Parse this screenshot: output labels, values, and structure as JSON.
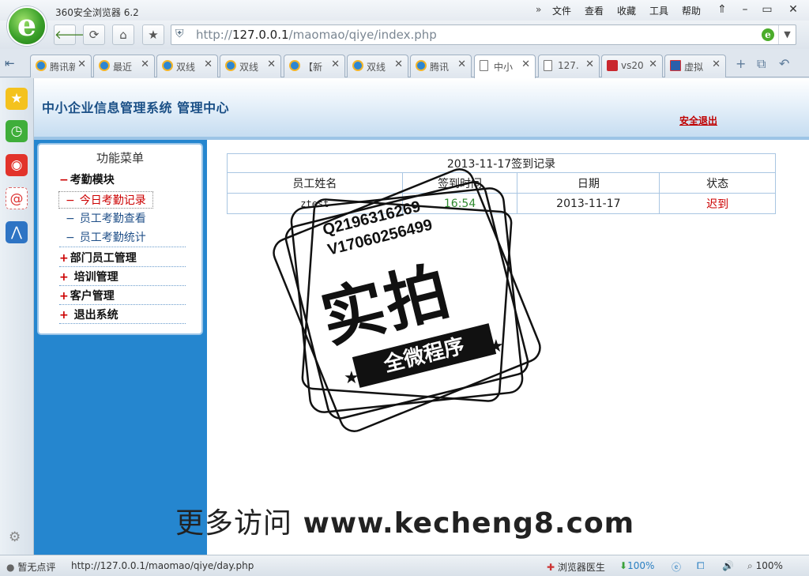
{
  "browser": {
    "app_title": "360安全浏览器 6.2",
    "menu_more": "»",
    "menus": [
      "文件",
      "查看",
      "收藏",
      "工具",
      "帮助"
    ],
    "window_buttons": [
      "⇑",
      "–",
      "▭",
      "✕"
    ],
    "address": {
      "scheme": "http://",
      "host": "127.0.0.1",
      "path": "/maomao/qiye/index.php"
    },
    "tabs": [
      {
        "label": "腾讯新",
        "icon": "ie-icon"
      },
      {
        "label": "最近",
        "icon": "ie-icon"
      },
      {
        "label": "双线",
        "icon": "ie-icon"
      },
      {
        "label": "双线",
        "icon": "ie-icon"
      },
      {
        "label": "【新",
        "icon": "ie-icon"
      },
      {
        "label": "双线",
        "icon": "ie-icon"
      },
      {
        "label": "腾讯",
        "icon": "ie-icon"
      },
      {
        "label": "中小",
        "icon": "doc-icon"
      },
      {
        "label": "127.",
        "icon": "doc-icon"
      },
      {
        "label": "vs20",
        "icon": "csdn-icon"
      },
      {
        "label": "虚拟",
        "icon": "vm-icon"
      }
    ],
    "status": {
      "left": "暂无点评",
      "url": "http://127.0.0.1/maomao/qiye/day.php",
      "doctor": "浏览器医生",
      "download": "100%",
      "zoom": "100%"
    }
  },
  "site": {
    "title": "中小企业信息管理系统  管理中心",
    "logout": "安全退出",
    "menu": {
      "title": "功能菜单",
      "attendance_module": {
        "sign": "−",
        "label": "考勤模块"
      },
      "sub_items": [
        {
          "dash": "−",
          "label": "今日考勤记录"
        },
        {
          "dash": "−",
          "label": "员工考勤查看"
        },
        {
          "dash": "−",
          "label": "员工考勤统计"
        }
      ],
      "modules": [
        {
          "sign": "+",
          "label": "部门员工管理"
        },
        {
          "sign": "+",
          "label": " 培训管理"
        },
        {
          "sign": "+",
          "label": "客户管理"
        },
        {
          "sign": "+",
          "label": " 退出系统"
        }
      ]
    },
    "record": {
      "caption": "2013-11-17签到记录",
      "headers": [
        "员工姓名",
        "签到时间",
        "日期",
        "状态"
      ],
      "rows": [
        {
          "name": "ztest",
          "time": "16:54",
          "date": "2013-11-17",
          "status": "迟到"
        }
      ]
    }
  },
  "watermark": {
    "contact_q": "Q2196316269",
    "contact_v": "V17060256499",
    "main": "实拍",
    "band": "全微程序",
    "bottom_cn": "更多访问",
    "bottom_url": "www.kecheng8.com"
  },
  "colors": {
    "accent_blue": "#2586cf",
    "header_text": "#1a4f86",
    "alert_red": "#c00000",
    "ok_green": "#2f8a2f"
  }
}
